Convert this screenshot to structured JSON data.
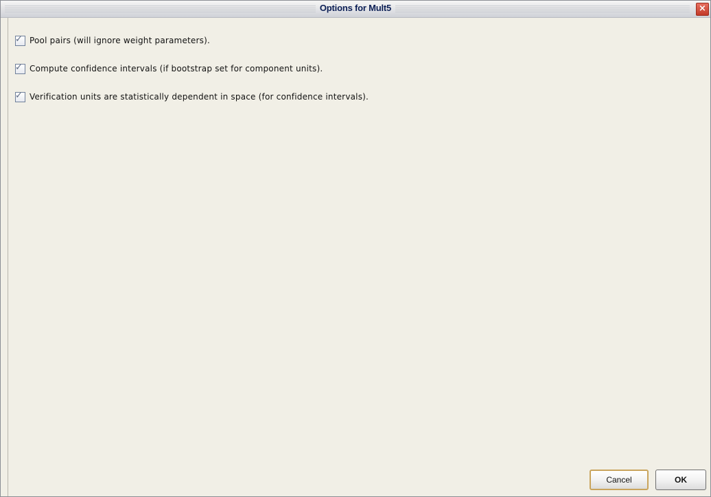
{
  "window": {
    "title": "Options for Mult5",
    "close_glyph": "×"
  },
  "options": [
    {
      "label": "Pool pairs (will ignore weight parameters).",
      "checked": true
    },
    {
      "label": "Compute confidence intervals (if bootstrap set for component units).",
      "checked": true
    },
    {
      "label": "Verification units are statistically dependent in space (for confidence intervals).",
      "checked": true
    }
  ],
  "buttons": {
    "cancel_label": "Cancel",
    "ok_label": "OK"
  },
  "colors": {
    "background": "#f1efe6",
    "title_text": "#0c1f55",
    "close_button": "#c23a28",
    "focus_ring": "#c9a45c"
  }
}
